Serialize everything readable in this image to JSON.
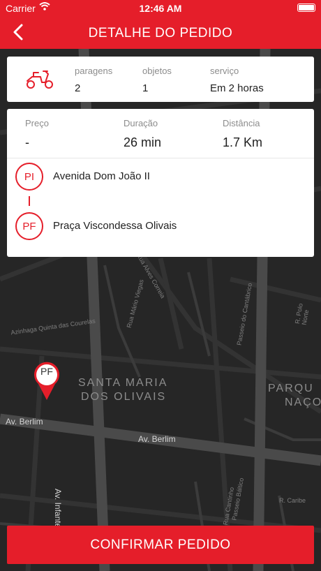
{
  "status_bar": {
    "carrier": "Carrier",
    "time": "12:46 AM"
  },
  "header": {
    "title": "DETALHE DO PEDIDO"
  },
  "summary": {
    "stops_label": "paragens",
    "stops_value": "2",
    "objects_label": "objetos",
    "objects_value": "1",
    "service_label": "serviço",
    "service_value": "Em 2 horas"
  },
  "details": {
    "price_label": "Preço",
    "price_value": "-",
    "duration_label": "Duração",
    "duration_value": "26 min",
    "distance_label": "Distância",
    "distance_value": "1.7 Km"
  },
  "route": {
    "start_badge": "PI",
    "start_address": "Avenida Dom João II",
    "end_badge": "PF",
    "end_address": "Praça Viscondessa Olivais"
  },
  "map": {
    "area1_line1": "SANTA MARIA",
    "area1_line2": "DOS OLIVAIS",
    "area2_line1": "PARQU",
    "area2_line2": "NAÇO",
    "street_berlim_1": "Av. Berlim",
    "street_berlim_2": "Av. Berlim",
    "street_infante": "Av. Infante Dom H",
    "small_1": "Azinhaga Quinta das Courelas",
    "small_2": "Rua Cantinho",
    "small_3": "Passeio Báltico",
    "small_4": "R. Caribe",
    "small_5": "Passeio do Cantábrico",
    "small_6": "R. Polo Norte",
    "small_7": "Rua Mário Viegas",
    "small_8": "Rua Alves Correia",
    "pin_label": "PF"
  },
  "confirm_button": "CONFIRMAR PEDIDO",
  "colors": {
    "accent": "#e51e2a",
    "map_bg": "#262626",
    "card_bg": "#ffffff"
  },
  "icons": {
    "back": "chevron-left-icon",
    "scooter": "scooter-icon",
    "wifi": "wifi-icon",
    "battery": "battery-icon",
    "pin": "map-pin-icon"
  }
}
